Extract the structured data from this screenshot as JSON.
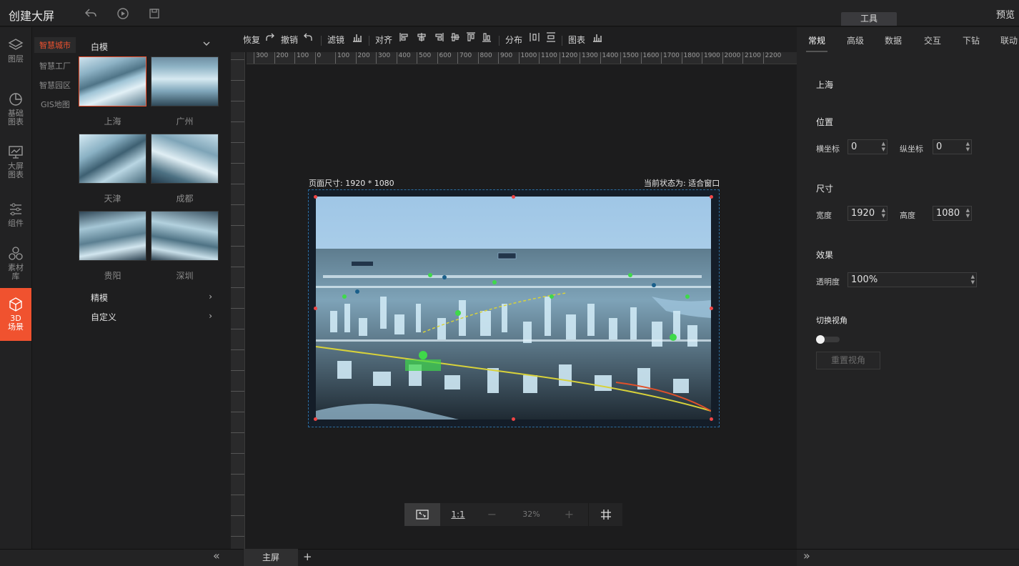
{
  "header": {
    "title": "创建大屏",
    "tool_tab": "工具",
    "preview": "预览"
  },
  "leftnav": [
    {
      "label": "图层",
      "icon": "layers-icon"
    },
    {
      "label": "基础\n图表",
      "icon": "pie-chart-icon"
    },
    {
      "label": "大屏\n图表",
      "icon": "presentation-chart-icon"
    },
    {
      "label": "组件",
      "icon": "sliders-icon"
    },
    {
      "label": "素材\n库",
      "icon": "assets-icon"
    },
    {
      "label": "3D\n场景",
      "icon": "cube-icon",
      "active": true
    }
  ],
  "panel": {
    "categories": [
      "智慧城市",
      "智慧工厂",
      "智慧园区",
      "GIS地图"
    ],
    "model_select": "白模",
    "thumbs": [
      "上海",
      "广州",
      "天津",
      "成都",
      "贵阳",
      "深圳"
    ],
    "sub_rows": [
      "精模",
      "自定义"
    ]
  },
  "toolbar": {
    "redo": "恢复",
    "undo": "撤销",
    "filter": "滤镜",
    "align": "对齐",
    "distribute": "分布",
    "chart": "图表"
  },
  "ruler": {
    "h_labels": [
      "300",
      "200",
      "100",
      "0",
      "100",
      "200",
      "300",
      "400",
      "500",
      "600",
      "700",
      "800",
      "900",
      "1000",
      "1100",
      "1200",
      "1300",
      "1400",
      "1500",
      "1600",
      "1700",
      "1800",
      "1900",
      "2000",
      "2100",
      "2200"
    ]
  },
  "canvas": {
    "page_size": "页面尺寸: 1920 * 1080",
    "state": "当前状态为: 适合窗口"
  },
  "zoombar": {
    "ratio": "1:1",
    "minus": "−",
    "zoom": "32%",
    "plus": "+"
  },
  "tabs": {
    "main": "主屏",
    "add": "+"
  },
  "right": {
    "tabs": [
      "常规",
      "高级",
      "数据",
      "交互",
      "下钻",
      "联动"
    ],
    "scene_name": "上海",
    "position_title": "位置",
    "x_label": "横坐标",
    "x_value": "0",
    "y_label": "纵坐标",
    "y_value": "0",
    "size_title": "尺寸",
    "w_label": "宽度",
    "w_value": "1920",
    "h_label": "高度",
    "h_value": "1080",
    "effect_title": "效果",
    "opacity_label": "透明度",
    "opacity_value": "100%",
    "view_title": "切换视角",
    "view_toggle_on": false,
    "reset_view": "重置视角"
  },
  "colors": {
    "accent": "#f0522f",
    "selection": "#2c6da0",
    "handle": "#f04545"
  }
}
